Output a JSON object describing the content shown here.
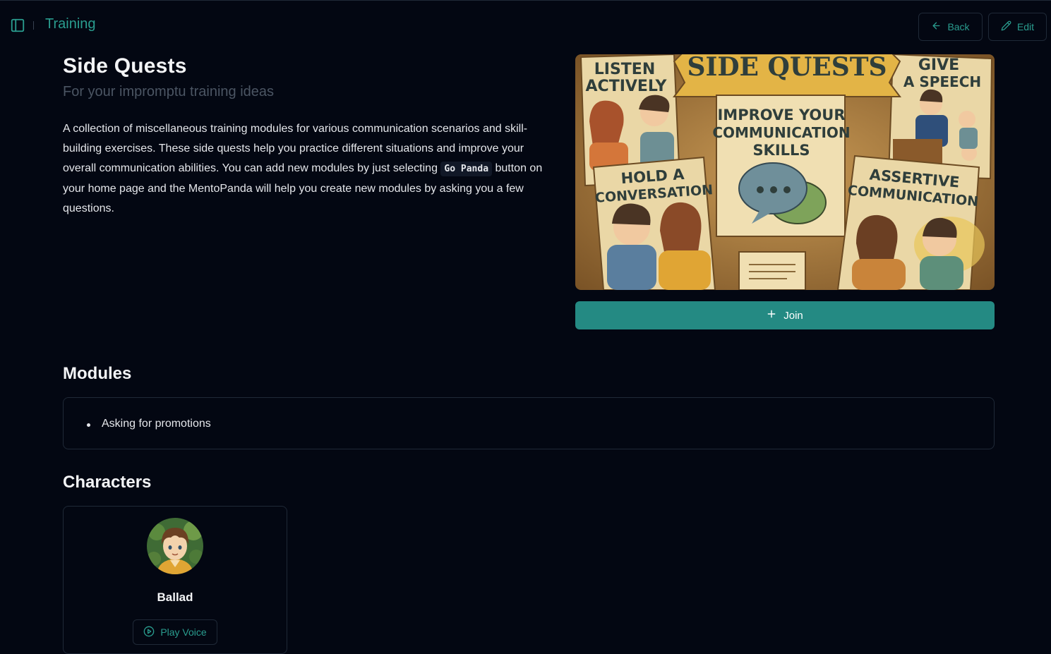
{
  "header": {
    "title": "Training",
    "back_label": "Back",
    "edit_label": "Edit"
  },
  "training": {
    "title": "Side Quests",
    "subtitle": "For your impromptu training ideas",
    "description_part1": "A collection of miscellaneous training modules for various communication scenarios and skill-building exercises. These side quests help you practice different situations and improve your overall communication abilities. You can add new modules by just selecting ",
    "description_code": "Go Panda",
    "description_part2": " button on your home page and the MentoPanda will help you create new modules by asking you a few questions.",
    "join_label": "Join"
  },
  "hero_image": {
    "banner": "SIDE QUESTS",
    "panels": {
      "top_left": [
        "LISTEN",
        "ACTIVELY"
      ],
      "top_right": [
        "GIVE",
        "A SPEECH"
      ],
      "center": [
        "IMPROVE YOUR",
        "COMMUNICATION",
        "SKILLS"
      ],
      "bottom_left": [
        "HOLD A",
        "CONVERSATION"
      ],
      "bottom_right": [
        "ASSERTIVE",
        "COMMUNICATION"
      ]
    }
  },
  "modules": {
    "heading": "Modules",
    "items": [
      "Asking for promotions"
    ]
  },
  "characters": {
    "heading": "Characters",
    "items": [
      {
        "name": "Ballad",
        "play_label": "Play Voice"
      }
    ]
  },
  "colors": {
    "background": "#030712",
    "accent": "#2a9d8f",
    "join_button": "#248a83",
    "border": "#1f2937"
  },
  "icons": {
    "sidebar_toggle": "sidebar-panel-icon",
    "back": "arrow-left-icon",
    "edit": "pencil-icon",
    "join": "plus-icon",
    "play": "play-circle-icon"
  }
}
